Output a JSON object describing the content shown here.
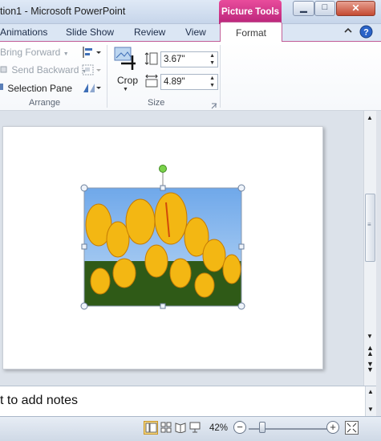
{
  "window": {
    "title": "tion1  -  Microsoft PowerPoint",
    "context_tab": "Picture Tools",
    "controls": {
      "minimize_icon": "minimize-icon",
      "maximize_icon": "maximize-icon",
      "close_icon": "close-icon"
    }
  },
  "ribbon_tabs": [
    "Animations",
    "Slide Show",
    "Review",
    "View",
    "Format"
  ],
  "active_tab": "Format",
  "ribbon": {
    "arrange": {
      "bring_forward": "Bring Forward",
      "send_backward": "Send Backward",
      "selection_pane": "Selection Pane",
      "label": "Arrange"
    },
    "size": {
      "crop": "Crop",
      "height": "3.67\"",
      "width": "4.89\"",
      "label": "Size"
    }
  },
  "notes": {
    "placeholder": "t to add notes"
  },
  "statusbar": {
    "zoom": "42%"
  },
  "colors": {
    "accent": "#c23a8a",
    "ribbon_bg": "#ffffff",
    "workspace": "#dce2ea"
  }
}
